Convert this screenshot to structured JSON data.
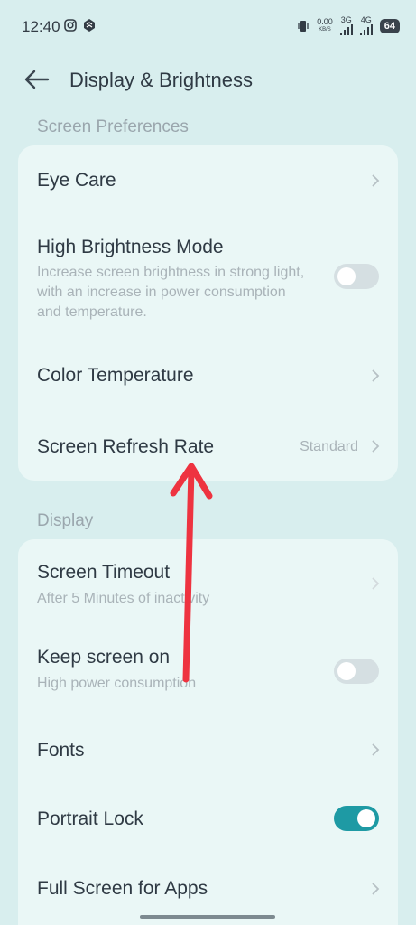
{
  "status_bar": {
    "time": "12:40",
    "net_speed_top": "0.00",
    "net_speed_unit": "KB/S",
    "sim1": "3G",
    "sim2": "4G",
    "battery": "64"
  },
  "header": {
    "title": "Display & Brightness"
  },
  "section1": {
    "label": "Screen Preferences",
    "items": [
      {
        "title": "Eye Care"
      },
      {
        "title": "High Brightness Mode",
        "subtitle": "Increase screen brightness in strong light, with an increase in power consumption and temperature.",
        "toggle": false
      },
      {
        "title": "Color Temperature"
      },
      {
        "title": "Screen Refresh Rate",
        "value": "Standard"
      }
    ]
  },
  "section2": {
    "label": "Display",
    "items": [
      {
        "title": "Screen Timeout",
        "subtitle": "After 5 Minutes of inactivity"
      },
      {
        "title": "Keep screen on",
        "subtitle": "High power consumption",
        "toggle": false
      },
      {
        "title": "Fonts"
      },
      {
        "title": "Portrait Lock",
        "toggle": true
      },
      {
        "title": "Full Screen for Apps"
      }
    ]
  },
  "colors": {
    "accent": "#1e9aa4",
    "annotation_arrow": "#ee3340",
    "background": "#d8eeee"
  }
}
